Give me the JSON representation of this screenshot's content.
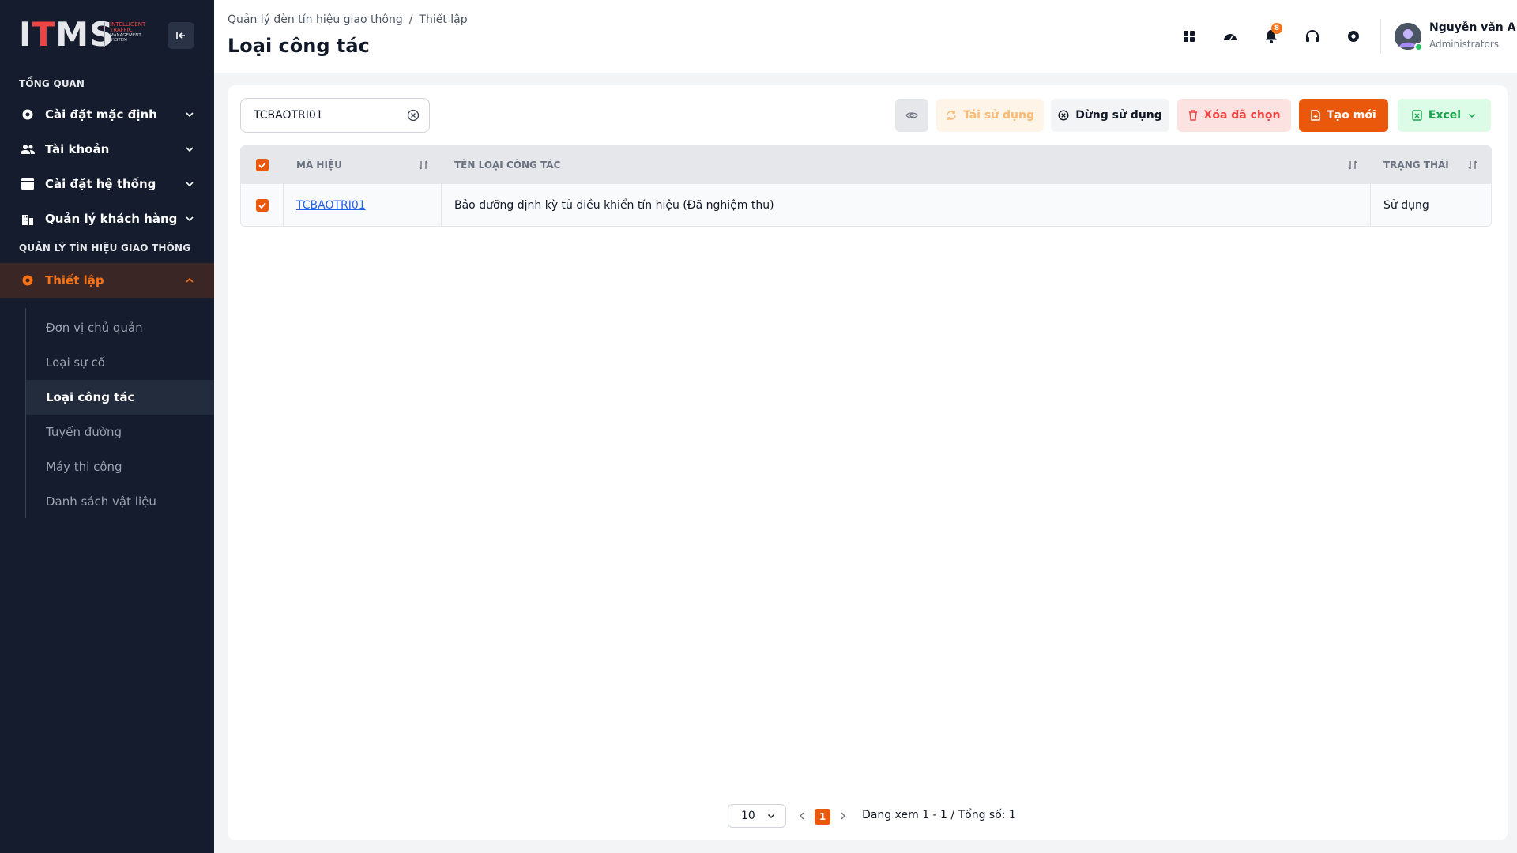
{
  "logo": {
    "main": "ITMS",
    "line1": "INTELLIGENT",
    "line2": "TRAFFIC",
    "line3": "MANAGEMENT",
    "line4": "SYSTEM"
  },
  "sidebar": {
    "section1": "TỔNG QUAN",
    "items": [
      {
        "label": "Cài đặt mặc định",
        "icon": "gear-icon"
      },
      {
        "label": "Tài khoản",
        "icon": "users-icon"
      },
      {
        "label": "Cài đặt hệ thống",
        "icon": "window-icon"
      },
      {
        "label": "Quản lý khách hàng",
        "icon": "building-icon"
      }
    ],
    "section2": "QUẢN LÝ TÍN HIỆU GIAO THÔNG",
    "active_group": {
      "label": "Thiết lập",
      "icon": "gear-icon"
    },
    "sub_items": [
      {
        "label": "Đơn vị chủ quản"
      },
      {
        "label": "Loại sự cố"
      },
      {
        "label": "Loại công tác"
      },
      {
        "label": "Tuyến đường"
      },
      {
        "label": "Máy thi công"
      },
      {
        "label": "Danh sách vật liệu"
      }
    ]
  },
  "header": {
    "breadcrumb": [
      "Quản lý đèn tín hiệu giao thông",
      "/",
      "Thiết lập"
    ],
    "title": "Loại công tác",
    "notification_count": "8",
    "user_name": "Nguyễn văn A",
    "user_role": "Administrators"
  },
  "toolbar": {
    "search_value": "TCBAOTRI01",
    "reuse_label": "Tái sử dụng",
    "stop_label": "Dừng sử dụng",
    "delete_label": "Xóa đã chọn",
    "new_label": "Tạo mới",
    "excel_label": "Excel"
  },
  "table": {
    "columns": [
      "MÃ HIỆU",
      "TÊN LOẠI CÔNG TÁC",
      "TRẠNG THÁI"
    ],
    "rows": [
      {
        "code": "TCBAOTRI01",
        "name": "Bảo dưỡng định kỳ tủ điều khiển tín hiệu (Đã nghiệm thu)",
        "status": "Sử dụng"
      }
    ]
  },
  "pagination": {
    "page_size": "10",
    "current_page": "1",
    "info": "Đang xem 1 - 1 / Tổng số: 1"
  },
  "colors": {
    "accent": "#ea580c",
    "sidebar_bg": "#141c2e",
    "excel_green": "#16a34a",
    "danger": "#ef4444"
  }
}
